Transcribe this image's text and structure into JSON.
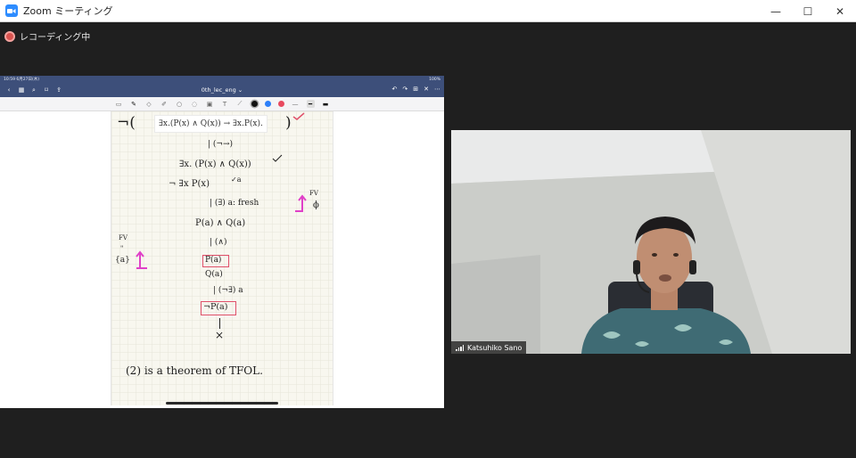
{
  "window": {
    "title": "Zoom ミーティング",
    "controls": {
      "minimize": "—",
      "maximize": "☐",
      "close": "✕"
    }
  },
  "recording": {
    "label": "レコーディング中"
  },
  "share": {
    "status": {
      "time": "10:59",
      "date": "6月27日(木)",
      "battery": "100%"
    },
    "doc_title": "0th_lec_eng",
    "doc_title_chevron": "⌄",
    "tool_colors": [
      "#111111",
      "#2d7ff9",
      "#e84a5f"
    ],
    "notes": {
      "formula": "∃x.(P(x) ∧ Q(x)) → ∃x.P(x).",
      "neg_open": "¬(",
      "close_paren": ")",
      "rule1": "| (¬→)",
      "line1": "∃x. (P(x) ∧ Q(x))",
      "line2": "¬ ∃x P(x)",
      "check_a": "✓a",
      "rule2": "| (∃)  a: fresh",
      "side_note": "FV",
      "side_phi": "ϕ",
      "line3": "P(a) ∧ Q(a)",
      "rule3": "| (∧)",
      "left_fv": "FV",
      "left_eq": "\"",
      "left_set": "{a}",
      "line4": "P(a)",
      "line5": "Q(a)",
      "rule4": "| (¬∃) a",
      "line6": "¬P(a)",
      "cross": "×",
      "conclusion": "(2) is a theorem of TFOL."
    }
  },
  "video": {
    "participant_name": "Katsuhiko Sano"
  }
}
